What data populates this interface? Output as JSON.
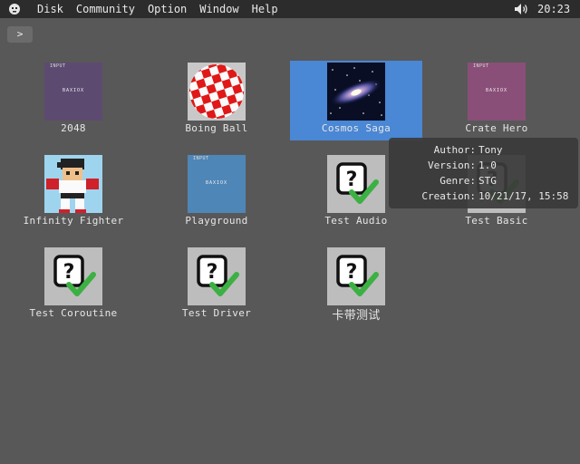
{
  "menubar": {
    "items": [
      "Disk",
      "Community",
      "Option",
      "Window",
      "Help"
    ],
    "clock": "20:23"
  },
  "path_button": {
    "label": ">"
  },
  "items": [
    {
      "label": "2048",
      "thumb_type": "cart",
      "thumb_title": "INPUT",
      "thumb_tag": "BAXIOX",
      "color": "#5d4a70"
    },
    {
      "label": "Boing Ball",
      "thumb_type": "boing"
    },
    {
      "label": "Cosmos Saga",
      "thumb_type": "galaxy",
      "selected": true
    },
    {
      "label": "Crate Hero",
      "thumb_type": "cart",
      "thumb_title": "INPUT",
      "thumb_tag": "BAXIOX",
      "color": "#8a4f78"
    },
    {
      "label": "Infinity Fighter",
      "thumb_type": "fighter"
    },
    {
      "label": "Playground",
      "thumb_type": "cart",
      "thumb_title": "INPUT",
      "thumb_tag": "BAXIOX",
      "color": "#4f86b8"
    },
    {
      "label": "Test Audio",
      "thumb_type": "test"
    },
    {
      "label": "Test Basic",
      "thumb_type": "test"
    },
    {
      "label": "Test Coroutine",
      "thumb_type": "test"
    },
    {
      "label": "Test Driver",
      "thumb_type": "test"
    },
    {
      "label": "卡带测试",
      "thumb_type": "test"
    }
  ],
  "tooltip": {
    "rows": [
      {
        "key": "Author:",
        "value": "Tony"
      },
      {
        "key": "Version:",
        "value": "1.0"
      },
      {
        "key": "Genre:",
        "value": "STG"
      },
      {
        "key": "Creation:",
        "value": "10/21/17, 15:58"
      }
    ]
  },
  "colors": {
    "background": "#585858",
    "menubar": "#2c2c2c",
    "selection": "#4a87d4",
    "check": "#3cb043"
  }
}
